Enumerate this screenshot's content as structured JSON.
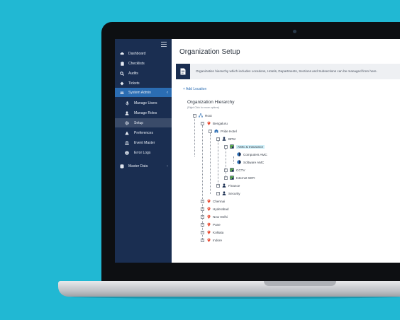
{
  "sidebar": {
    "items": [
      {
        "label": "Dashboard",
        "icon": "cloud-icon"
      },
      {
        "label": "Checklists",
        "icon": "clipboard-icon"
      },
      {
        "label": "Audits",
        "icon": "search-icon"
      },
      {
        "label": "Tickets",
        "icon": "ticket-icon"
      },
      {
        "label": "System Admin",
        "icon": "users-icon"
      },
      {
        "label": "Manage Users",
        "icon": "mic-icon"
      },
      {
        "label": "Manage Roles",
        "icon": "user-icon"
      },
      {
        "label": "Setup",
        "icon": "gear-icon"
      },
      {
        "label": "Preferences",
        "icon": "triangle-icon"
      },
      {
        "label": "Event Master",
        "icon": "bank-icon"
      },
      {
        "label": "Error Logs",
        "icon": "info-icon"
      },
      {
        "label": "Master Data",
        "icon": "database-icon"
      }
    ],
    "colors": {
      "bg": "#1a2e51",
      "active": "#2b6db3",
      "setup": "#3a4b69"
    }
  },
  "page": {
    "title": "Organization Setup",
    "info_text": "Organization hierarchy which includes Locations, Hotels, Departments, Sections and Subsections can be managed from here.",
    "add_location": "+ Add Location",
    "tree_title": "Organization Hierarchy",
    "tree_subtitle": "(Right Click for more options)"
  },
  "tree": {
    "root": "Root",
    "bengaluru": "Bengaluru",
    "pride_hotel": "Pride Hotel",
    "bpm": "BPM",
    "amc_insurance": "AMC & Insurance",
    "computers_amc": "Computers AMC",
    "software_amc": "Software AMC",
    "cctv": "CCTV",
    "internet_wifi": "Internet WIFI",
    "finance": "Finance",
    "security": "Security",
    "chennai": "Chennai",
    "hyderabad": "Hyderabad",
    "new_delhi": "New Delhi",
    "pune": "Pune",
    "kolkata": "Kolkata",
    "indore": "Indore"
  },
  "colors": {
    "background": "#21b8d3",
    "pin": "#e8452c",
    "accent": "#2b6db3",
    "selected": "#cdeef7"
  }
}
